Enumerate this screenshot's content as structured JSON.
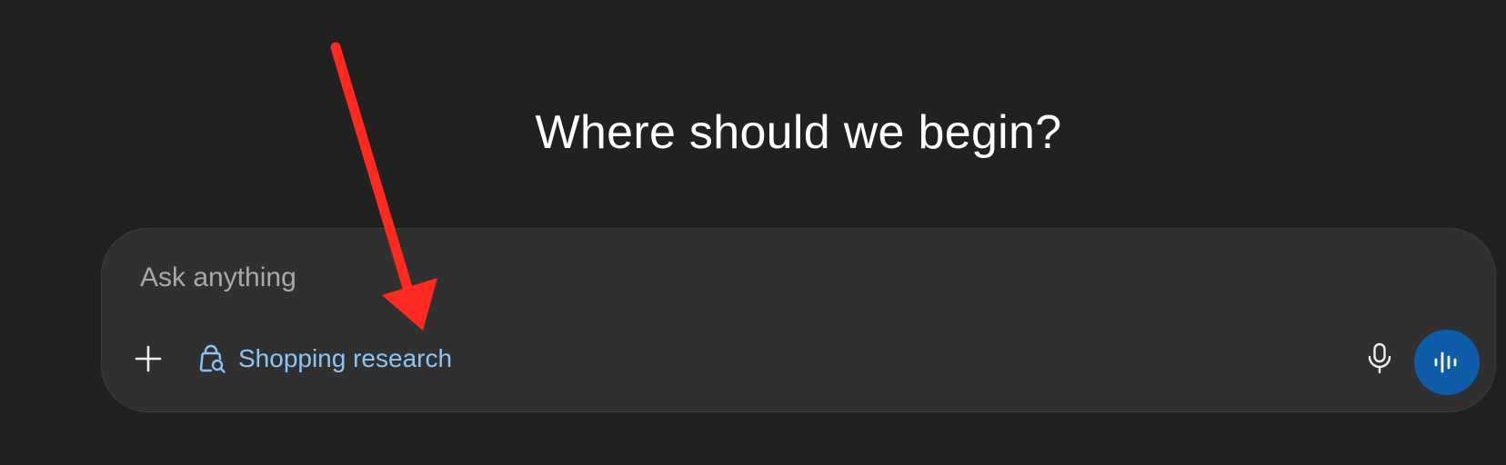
{
  "main": {
    "heading": "Where should we begin?"
  },
  "composer": {
    "placeholder": "Ask anything",
    "value": "",
    "shopping_label": "Shopping research"
  },
  "icons": {
    "add": "plus-icon",
    "shopping": "shopping-bag-search-icon",
    "mic": "microphone-icon",
    "voice": "voice-waveform-icon",
    "annotation": "red-arrow-annotation"
  },
  "colors": {
    "background": "#212121",
    "composer_bg": "#303030",
    "accent_link": "#8cc4f5",
    "voice_button": "#0f5ca8",
    "annotation": "#ff2a1f"
  }
}
